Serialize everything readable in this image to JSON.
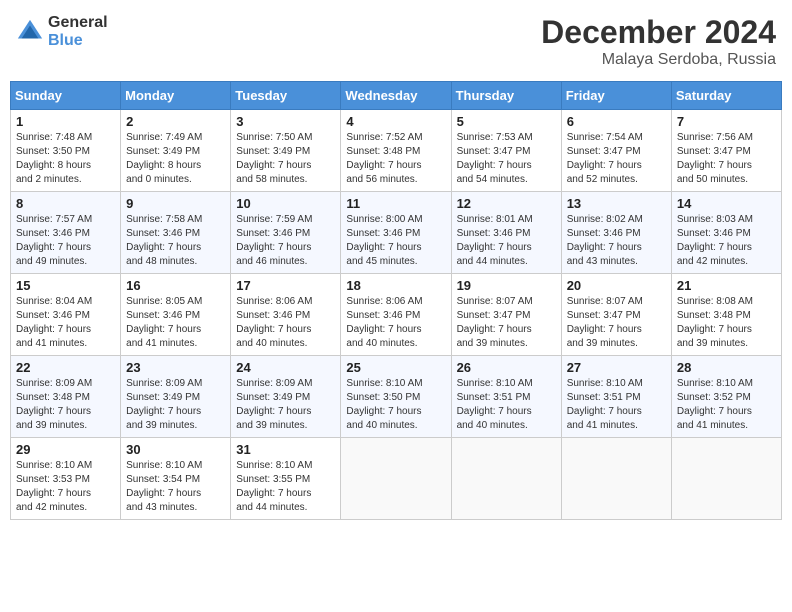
{
  "header": {
    "logo_general": "General",
    "logo_blue": "Blue",
    "month_title": "December 2024",
    "location": "Malaya Serdoba, Russia"
  },
  "calendar": {
    "days_of_week": [
      "Sunday",
      "Monday",
      "Tuesday",
      "Wednesday",
      "Thursday",
      "Friday",
      "Saturday"
    ],
    "weeks": [
      [
        {
          "day": "1",
          "info": "Sunrise: 7:48 AM\nSunset: 3:50 PM\nDaylight: 8 hours\nand 2 minutes."
        },
        {
          "day": "2",
          "info": "Sunrise: 7:49 AM\nSunset: 3:49 PM\nDaylight: 8 hours\nand 0 minutes."
        },
        {
          "day": "3",
          "info": "Sunrise: 7:50 AM\nSunset: 3:49 PM\nDaylight: 7 hours\nand 58 minutes."
        },
        {
          "day": "4",
          "info": "Sunrise: 7:52 AM\nSunset: 3:48 PM\nDaylight: 7 hours\nand 56 minutes."
        },
        {
          "day": "5",
          "info": "Sunrise: 7:53 AM\nSunset: 3:47 PM\nDaylight: 7 hours\nand 54 minutes."
        },
        {
          "day": "6",
          "info": "Sunrise: 7:54 AM\nSunset: 3:47 PM\nDaylight: 7 hours\nand 52 minutes."
        },
        {
          "day": "7",
          "info": "Sunrise: 7:56 AM\nSunset: 3:47 PM\nDaylight: 7 hours\nand 50 minutes."
        }
      ],
      [
        {
          "day": "8",
          "info": "Sunrise: 7:57 AM\nSunset: 3:46 PM\nDaylight: 7 hours\nand 49 minutes."
        },
        {
          "day": "9",
          "info": "Sunrise: 7:58 AM\nSunset: 3:46 PM\nDaylight: 7 hours\nand 48 minutes."
        },
        {
          "day": "10",
          "info": "Sunrise: 7:59 AM\nSunset: 3:46 PM\nDaylight: 7 hours\nand 46 minutes."
        },
        {
          "day": "11",
          "info": "Sunrise: 8:00 AM\nSunset: 3:46 PM\nDaylight: 7 hours\nand 45 minutes."
        },
        {
          "day": "12",
          "info": "Sunrise: 8:01 AM\nSunset: 3:46 PM\nDaylight: 7 hours\nand 44 minutes."
        },
        {
          "day": "13",
          "info": "Sunrise: 8:02 AM\nSunset: 3:46 PM\nDaylight: 7 hours\nand 43 minutes."
        },
        {
          "day": "14",
          "info": "Sunrise: 8:03 AM\nSunset: 3:46 PM\nDaylight: 7 hours\nand 42 minutes."
        }
      ],
      [
        {
          "day": "15",
          "info": "Sunrise: 8:04 AM\nSunset: 3:46 PM\nDaylight: 7 hours\nand 41 minutes."
        },
        {
          "day": "16",
          "info": "Sunrise: 8:05 AM\nSunset: 3:46 PM\nDaylight: 7 hours\nand 41 minutes."
        },
        {
          "day": "17",
          "info": "Sunrise: 8:06 AM\nSunset: 3:46 PM\nDaylight: 7 hours\nand 40 minutes."
        },
        {
          "day": "18",
          "info": "Sunrise: 8:06 AM\nSunset: 3:46 PM\nDaylight: 7 hours\nand 40 minutes."
        },
        {
          "day": "19",
          "info": "Sunrise: 8:07 AM\nSunset: 3:47 PM\nDaylight: 7 hours\nand 39 minutes."
        },
        {
          "day": "20",
          "info": "Sunrise: 8:07 AM\nSunset: 3:47 PM\nDaylight: 7 hours\nand 39 minutes."
        },
        {
          "day": "21",
          "info": "Sunrise: 8:08 AM\nSunset: 3:48 PM\nDaylight: 7 hours\nand 39 minutes."
        }
      ],
      [
        {
          "day": "22",
          "info": "Sunrise: 8:09 AM\nSunset: 3:48 PM\nDaylight: 7 hours\nand 39 minutes."
        },
        {
          "day": "23",
          "info": "Sunrise: 8:09 AM\nSunset: 3:49 PM\nDaylight: 7 hours\nand 39 minutes."
        },
        {
          "day": "24",
          "info": "Sunrise: 8:09 AM\nSunset: 3:49 PM\nDaylight: 7 hours\nand 39 minutes."
        },
        {
          "day": "25",
          "info": "Sunrise: 8:10 AM\nSunset: 3:50 PM\nDaylight: 7 hours\nand 40 minutes."
        },
        {
          "day": "26",
          "info": "Sunrise: 8:10 AM\nSunset: 3:51 PM\nDaylight: 7 hours\nand 40 minutes."
        },
        {
          "day": "27",
          "info": "Sunrise: 8:10 AM\nSunset: 3:51 PM\nDaylight: 7 hours\nand 41 minutes."
        },
        {
          "day": "28",
          "info": "Sunrise: 8:10 AM\nSunset: 3:52 PM\nDaylight: 7 hours\nand 41 minutes."
        }
      ],
      [
        {
          "day": "29",
          "info": "Sunrise: 8:10 AM\nSunset: 3:53 PM\nDaylight: 7 hours\nand 42 minutes."
        },
        {
          "day": "30",
          "info": "Sunrise: 8:10 AM\nSunset: 3:54 PM\nDaylight: 7 hours\nand 43 minutes."
        },
        {
          "day": "31",
          "info": "Sunrise: 8:10 AM\nSunset: 3:55 PM\nDaylight: 7 hours\nand 44 minutes."
        },
        {
          "day": "",
          "info": ""
        },
        {
          "day": "",
          "info": ""
        },
        {
          "day": "",
          "info": ""
        },
        {
          "day": "",
          "info": ""
        }
      ]
    ]
  }
}
